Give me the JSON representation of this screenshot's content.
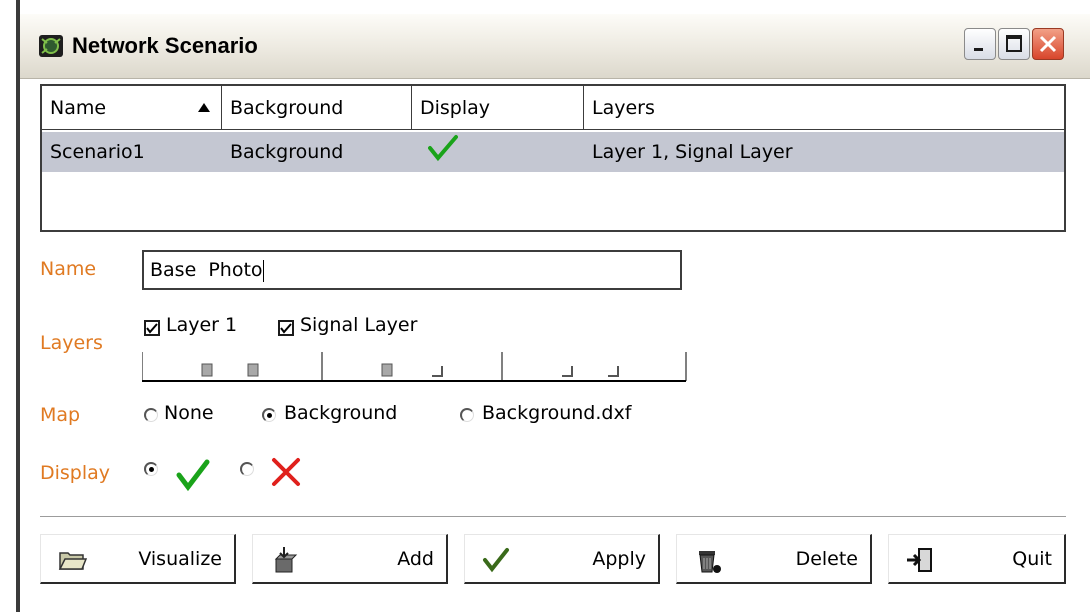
{
  "window": {
    "title": "Network Scenario"
  },
  "table": {
    "columns": [
      "Name",
      "Background",
      "Display",
      "Layers"
    ],
    "rows": [
      {
        "name": "Scenario1",
        "background": "Background",
        "display": "check",
        "layers": "Layer 1, Signal Layer"
      }
    ]
  },
  "form": {
    "name_label": "Name",
    "name_value": "Base  Photo",
    "layers_label": "Layers",
    "layer_options": [
      {
        "label": "Layer 1",
        "checked": true
      },
      {
        "label": "Signal Layer",
        "checked": true
      }
    ],
    "map_label": "Map",
    "map_options": [
      {
        "label": "None",
        "selected": false
      },
      {
        "label": "Background",
        "selected": true
      },
      {
        "label": "Background.dxf",
        "selected": false
      }
    ],
    "display_label": "Display",
    "display_options": [
      {
        "icon": "green-check-icon",
        "selected": true
      },
      {
        "icon": "red-x-icon",
        "selected": false
      }
    ]
  },
  "buttons": {
    "visualize": "Visualize",
    "add": "Add",
    "apply": "Apply",
    "delete": "Delete",
    "quit": "Quit"
  },
  "colors": {
    "label_orange": "#e07a22",
    "selection_row": "#c4c7d2",
    "check_green": "#1aa31a",
    "x_red": "#e0201c"
  }
}
